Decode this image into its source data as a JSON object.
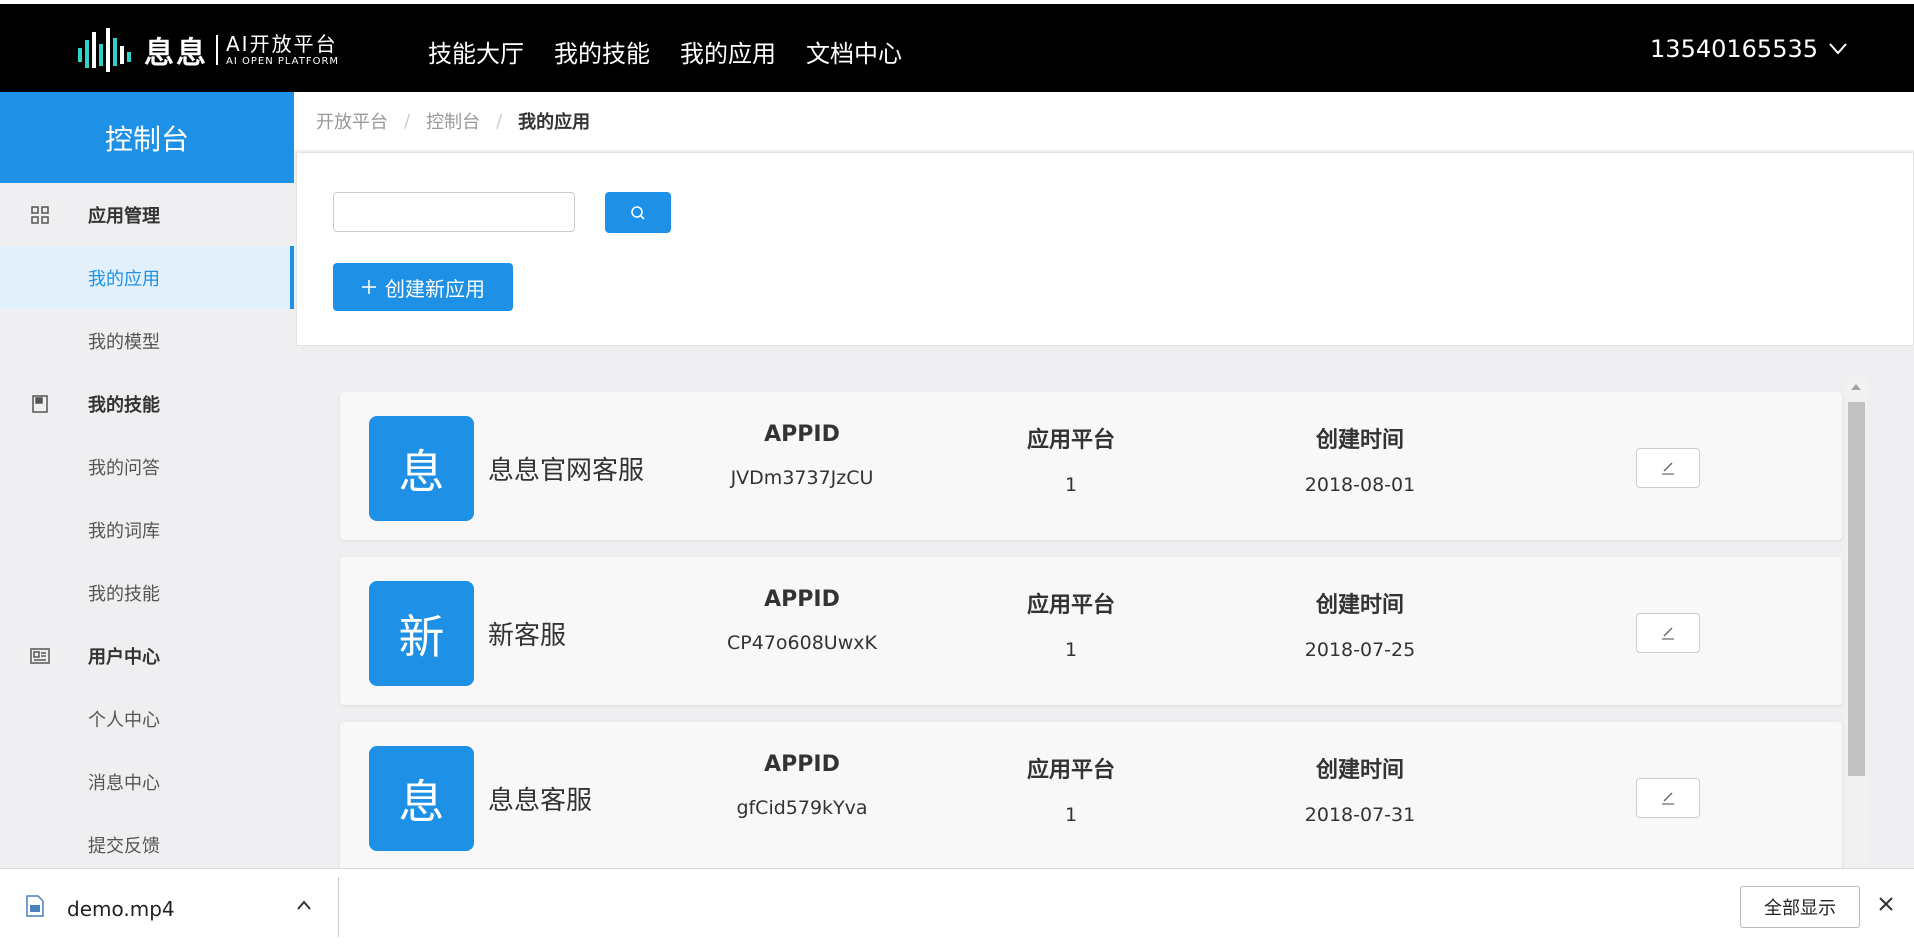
{
  "header": {
    "logo_brand": "息息",
    "logo_line1": "AI开放平台",
    "logo_line2": "AI OPEN PLATFORM",
    "nav": [
      "技能大厅",
      "我的技能",
      "我的应用",
      "文档中心"
    ],
    "user": "13540165535"
  },
  "sidebar": {
    "title": "控制台",
    "groups": [
      {
        "label": "应用管理",
        "icon": "grid-icon",
        "items": [
          "我的应用",
          "我的模型"
        ]
      },
      {
        "label": "我的技能",
        "icon": "book-icon",
        "items": [
          "我的问答",
          "我的词库",
          "我的技能"
        ]
      },
      {
        "label": "用户中心",
        "icon": "id-card-icon",
        "items": [
          "个人中心",
          "消息中心",
          "提交反馈"
        ]
      }
    ],
    "active_item": "我的应用"
  },
  "breadcrumb": [
    "开放平台",
    "控制台",
    "我的应用"
  ],
  "toolbar": {
    "search_value": "",
    "create_label": "创建新应用"
  },
  "app_columns": {
    "appid": "APPID",
    "platform": "应用平台",
    "created": "创建时间"
  },
  "apps": [
    {
      "avatar": "息",
      "name": "息息官网客服",
      "appid": "JVDm3737JzCU",
      "platform": "1",
      "created": "2018-08-01"
    },
    {
      "avatar": "新",
      "name": "新客服",
      "appid": "CP47o608UwxK",
      "platform": "1",
      "created": "2018-07-25"
    },
    {
      "avatar": "息",
      "name": "息息客服",
      "appid": "gfCid579kYva",
      "platform": "1",
      "created": "2018-07-31"
    }
  ],
  "download_bar": {
    "file_name": "demo.mp4",
    "show_all_label": "全部显示"
  },
  "colors": {
    "accent": "#1e90e6",
    "header_bg": "#000000",
    "sidebar_active_bg": "#e2f0fc"
  }
}
